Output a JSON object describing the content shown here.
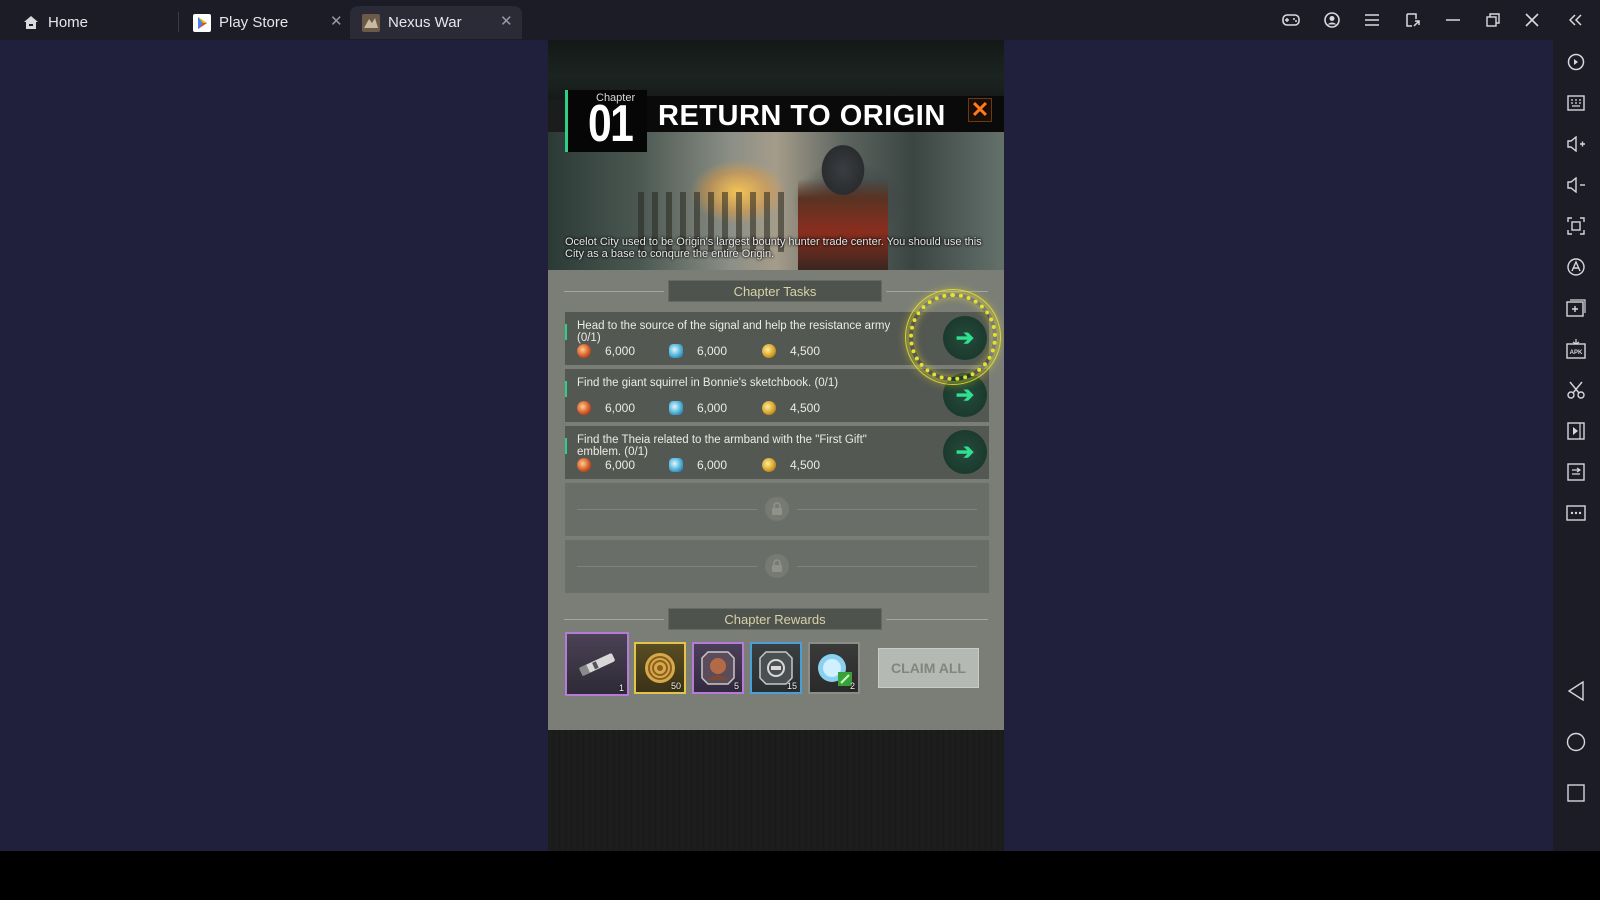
{
  "titlebar": {
    "tabs": [
      {
        "label": "Home",
        "icon": "home-icon"
      },
      {
        "label": "Play Store",
        "icon": "play-store-icon"
      },
      {
        "label": "Nexus War",
        "icon": "nexus-war-app-icon",
        "active": true
      }
    ],
    "controls": [
      "gamepad-icon",
      "account-icon",
      "menu-icon",
      "screen-rotate-icon",
      "minimize-icon",
      "restore-icon",
      "close-icon",
      "collapse-sidebar-icon"
    ]
  },
  "sidebar": {
    "icons": [
      "settings-icon",
      "keyboard-icon",
      "volume-up-icon",
      "volume-down-icon",
      "screenshot-icon",
      "macro-icon",
      "add-instance-icon",
      "apk-install-icon",
      "scissors-icon",
      "screen-record-icon",
      "file-manager-icon",
      "more-icon"
    ],
    "nav": [
      "back-icon",
      "home-nav-icon",
      "recents-icon"
    ]
  },
  "game": {
    "chapter_label": "Chapter",
    "chapter_number": "01",
    "chapter_title": "RETURN TO ORIGIN",
    "description": "Ocelot City used to be Origin's largest bounty hunter trade center. You should use this City as a base to conqure the entire Origin.",
    "close_symbol": "✕",
    "tasks_header": "Chapter Tasks",
    "tasks": [
      {
        "text": "Head to the source of the signal and help the resistance army (0/1)",
        "rewards": [
          "6,000",
          "6,000",
          "4,500"
        ],
        "highlighted": true
      },
      {
        "text": "Find the giant squirrel in Bonnie's sketchbook. (0/1)",
        "rewards": [
          "6,000",
          "6,000",
          "4,500"
        ],
        "highlighted": false
      },
      {
        "text": "Find the Theia related to the armband with the \"First Gift\" emblem. (0/1)",
        "rewards": [
          "6,000",
          "6,000",
          "4,500"
        ],
        "highlighted": false
      }
    ],
    "locked_slots": 2,
    "rewards_header": "Chapter Rewards",
    "chapter_rewards": [
      {
        "name": "weapon-part",
        "count": "1",
        "rarity_color": "#b67ad8"
      },
      {
        "name": "gold-coin-token",
        "count": "50",
        "rarity_color": "#e2c44a"
      },
      {
        "name": "character-portrait",
        "count": "5",
        "rarity_color": "#b67ad8"
      },
      {
        "name": "badge-token",
        "count": "15",
        "rarity_color": "#4aa0d6"
      },
      {
        "name": "speed-up-orb",
        "count": "2",
        "rarity_color": "#8a8d88"
      }
    ],
    "claim_all_label": "CLAIM ALL",
    "go_symbol": "➔"
  },
  "colors": {
    "accent_green": "#2fcf86",
    "highlight_yellow": "#e8e02a",
    "close_orange": "#ff7a1a"
  }
}
